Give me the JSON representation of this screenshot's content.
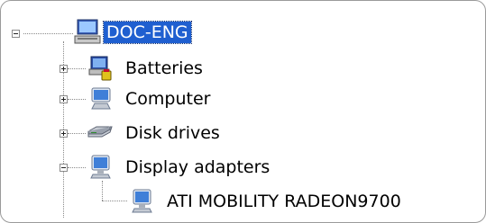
{
  "tree": {
    "root": {
      "label": "DOC-ENG",
      "icon": "computer-root-icon",
      "expanded": true,
      "selected": true
    },
    "nodes": [
      {
        "label": "Batteries",
        "icon": "battery-icon",
        "expanded": false
      },
      {
        "label": "Computer",
        "icon": "computer-icon",
        "expanded": false
      },
      {
        "label": "Disk drives",
        "icon": "disk-drive-icon",
        "expanded": false
      },
      {
        "label": "Display adapters",
        "icon": "monitor-icon",
        "expanded": true,
        "children": [
          {
            "label": "ATI MOBILITY RADEON9700",
            "icon": "display-adapter-icon"
          }
        ]
      }
    ]
  },
  "colors": {
    "selection": "#1f5fd0",
    "background": "#ffffff",
    "connector": "#8a8a8a"
  }
}
